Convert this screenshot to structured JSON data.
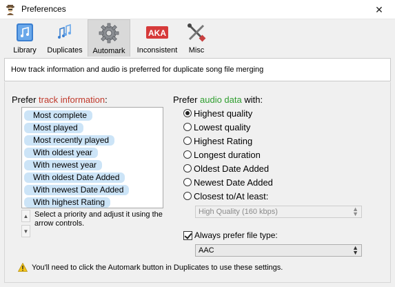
{
  "window": {
    "title": "Preferences"
  },
  "toolbar": {
    "tabs": [
      {
        "label": "Library",
        "icon": "library-icon"
      },
      {
        "label": "Duplicates",
        "icon": "duplicates-icon"
      },
      {
        "label": "Automark",
        "icon": "automark-gear-icon",
        "active": true
      },
      {
        "label": "Inconsistent",
        "icon": "aka-icon"
      },
      {
        "label": "Misc",
        "icon": "tools-icon"
      }
    ],
    "aka_text": "AKA"
  },
  "description": "How track information and audio is preferred for duplicate song file merging",
  "track_info": {
    "heading_prefix": "Prefer ",
    "heading_accent": "track information",
    "heading_suffix": ":",
    "items": [
      "Most complete",
      "Most played",
      "Most recently played",
      "With oldest year",
      "With newest year",
      "With oldest Date Added",
      "With newest Date Added",
      "With highest Rating"
    ],
    "hint": "Select a priority and adjust it using the arrow controls."
  },
  "audio": {
    "heading_prefix": "Prefer ",
    "heading_accent": "audio data",
    "heading_suffix": " with:",
    "options": [
      {
        "label": "Highest quality",
        "checked": true
      },
      {
        "label": "Lowest quality",
        "checked": false
      },
      {
        "label": "Highest Rating",
        "checked": false
      },
      {
        "label": "Longest duration",
        "checked": false
      },
      {
        "label": "Oldest Date Added",
        "checked": false
      },
      {
        "label": "Newest Date Added",
        "checked": false
      },
      {
        "label": "Closest to/At least:",
        "checked": false
      }
    ],
    "quality_select": "High Quality (160 kbps)",
    "always_prefer_label": "Always prefer file type:",
    "always_prefer_checked": true,
    "file_type_select": "AAC"
  },
  "footer": "You'll need to click the Automark button in Duplicates to use these settings.",
  "colors": {
    "accent_red": "#c0392b",
    "accent_green": "#2e9e2e",
    "selection": "#cce4f7"
  }
}
